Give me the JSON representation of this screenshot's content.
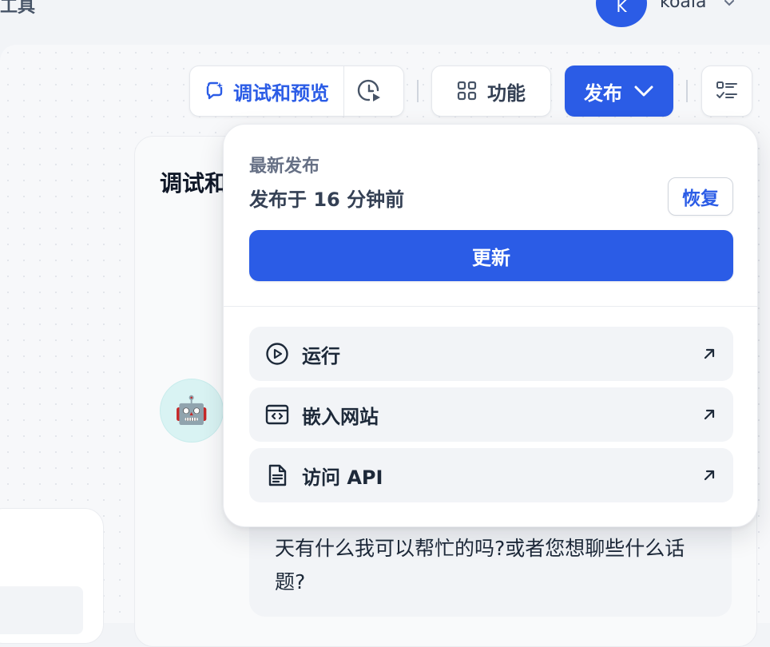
{
  "header": {
    "breadcrumb": "工具",
    "user_initial": "K",
    "user_name": "koala"
  },
  "toolbar": {
    "debug_label": "调试和预览",
    "features_label": "功能",
    "publish_label": "发布"
  },
  "debug_panel": {
    "title": "调试和预览",
    "bot_emoji": "🤖",
    "message": "天有什么我可以帮忙的吗?或者您想聊些什么话题?"
  },
  "publish_menu": {
    "latest_label": "最新发布",
    "published_time": "发布于 16 分钟前",
    "restore_label": "恢复",
    "update_label": "更新",
    "actions": [
      {
        "label": "运行",
        "icon": "play-circle-icon"
      },
      {
        "label": "嵌入网站",
        "icon": "embed-code-icon"
      },
      {
        "label": "访问 API",
        "icon": "document-icon"
      }
    ]
  },
  "colors": {
    "accent": "#2b5ce6",
    "background": "#f2f4f7"
  }
}
